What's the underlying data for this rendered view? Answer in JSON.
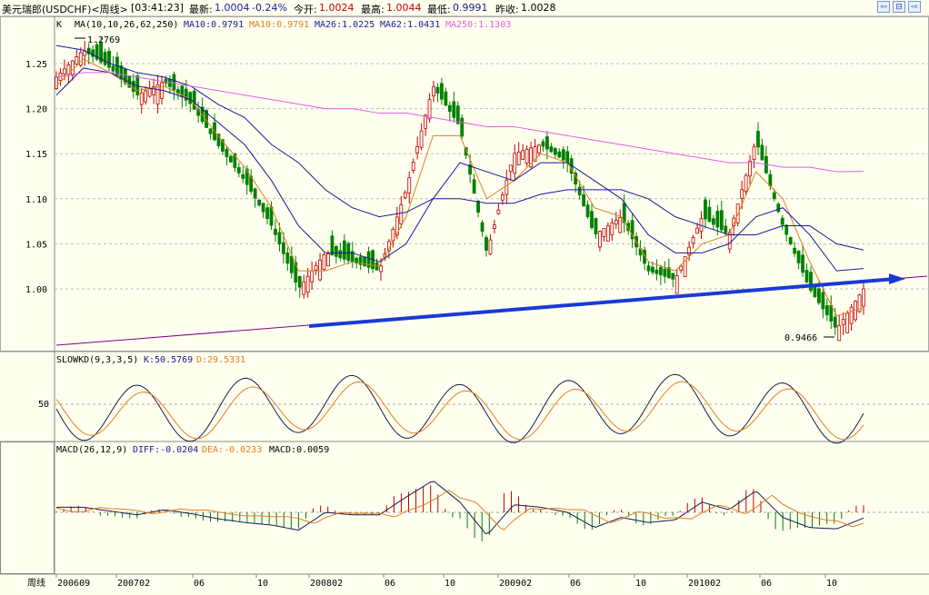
{
  "header": {
    "symbol": "美元瑞郎(USDCHF)<周线>",
    "time": "[03:41:23]",
    "latest_label": "最新:",
    "latest": "1.0004",
    "change": "-0.24%",
    "open_label": "今开:",
    "open": "1.0024",
    "high_label": "最高:",
    "high": "1.0044",
    "low_label": "最低:",
    "low": "0.9991",
    "prev_label": "昨收:",
    "prev": "1.0028",
    "nav_buttons": [
      "prev-arrow-icon",
      "expand-icon",
      "next-arrow-icon"
    ]
  },
  "main_panel": {
    "k_label": "K",
    "ma_label": "MA(10,10,26,62,250)",
    "ma_values": [
      {
        "text": "MA10:0.9791",
        "color": "#1a1a9a"
      },
      {
        "text": "MA10:0.9791",
        "color": "#e08020"
      },
      {
        "text": "MA26:1.0225",
        "color": "#1a1a9a"
      },
      {
        "text": "MA62:1.0431",
        "color": "#1a1a9a"
      },
      {
        "text": "MA250:1.1303",
        "color": "#e060e0"
      }
    ],
    "high_annotation": "1.2769",
    "low_annotation": "0.9466",
    "y_ticks": [
      "1.25",
      "1.20",
      "1.15",
      "1.10",
      "1.05",
      "1.00"
    ]
  },
  "kd_panel": {
    "label": "SLOWKD(9,3,3,5)",
    "k_text": "K:50.5769",
    "d_text": "D:29.5331",
    "y_tick": "50"
  },
  "macd_panel": {
    "label": "MACD(26,12,9)",
    "diff_text": "DIFF:-0.0204",
    "dea_text": "DEA:-0.0233",
    "macd_text": "MACD:0.0059",
    "y_tick": "0"
  },
  "x_axis": {
    "period_label": "周线",
    "ticks": [
      "200609",
      "200702",
      "06",
      "10",
      "200802",
      "06",
      "10",
      "200902",
      "06",
      "10",
      "201002",
      "06",
      "10"
    ]
  },
  "chart_data": {
    "type": "line",
    "title": "美元瑞郎(USDCHF)<周线>",
    "xlabel": "",
    "ylabel": "",
    "ylim": [
      0.935,
      1.29
    ],
    "x": [
      "2006-09",
      "2006-11",
      "2007-02",
      "2007-04",
      "2007-06",
      "2007-08",
      "2007-10",
      "2007-12",
      "2008-02",
      "2008-03",
      "2008-04",
      "2008-06",
      "2008-08",
      "2008-10",
      "2008-11",
      "2008-12",
      "2009-02",
      "2009-03",
      "2009-05",
      "2009-06",
      "2009-08",
      "2009-10",
      "2009-11",
      "2010-01",
      "2010-02",
      "2010-04",
      "2010-06",
      "2010-07",
      "2010-08",
      "2010-10",
      "2010-11"
    ],
    "series": [
      {
        "name": "K",
        "color": "#008000",
        "values": [
          1.235,
          1.265,
          1.245,
          1.215,
          1.23,
          1.205,
          1.16,
          1.12,
          1.07,
          1.0,
          1.04,
          1.03,
          1.02,
          1.11,
          1.225,
          1.18,
          1.04,
          1.15,
          1.16,
          1.14,
          1.06,
          1.08,
          1.02,
          1.01,
          1.08,
          1.06,
          1.165,
          1.07,
          1.0,
          0.955,
          1.0
        ]
      },
      {
        "name": "MA10",
        "color": "#e08020",
        "values": [
          1.225,
          1.255,
          1.24,
          1.22,
          1.225,
          1.21,
          1.17,
          1.135,
          1.09,
          1.02,
          1.02,
          1.03,
          1.025,
          1.08,
          1.17,
          1.17,
          1.1,
          1.12,
          1.15,
          1.14,
          1.09,
          1.08,
          1.03,
          1.02,
          1.05,
          1.06,
          1.13,
          1.1,
          1.03,
          0.97,
          0.979
        ]
      },
      {
        "name": "MA26",
        "color": "#1a1a9a",
        "values": [
          1.215,
          1.245,
          1.24,
          1.225,
          1.22,
          1.21,
          1.185,
          1.16,
          1.12,
          1.07,
          1.04,
          1.04,
          1.03,
          1.05,
          1.1,
          1.14,
          1.13,
          1.12,
          1.14,
          1.14,
          1.12,
          1.1,
          1.06,
          1.04,
          1.04,
          1.05,
          1.08,
          1.09,
          1.06,
          1.02,
          1.0225
        ]
      },
      {
        "name": "MA62",
        "color": "#1a1a9a",
        "values": [
          1.27,
          1.265,
          1.25,
          1.24,
          1.235,
          1.225,
          1.205,
          1.19,
          1.16,
          1.14,
          1.11,
          1.09,
          1.08,
          1.085,
          1.1,
          1.1,
          1.095,
          1.095,
          1.105,
          1.11,
          1.11,
          1.11,
          1.1,
          1.08,
          1.07,
          1.06,
          1.06,
          1.07,
          1.07,
          1.05,
          1.0431
        ]
      },
      {
        "name": "MA250",
        "color": "#e060e0",
        "values": [
          1.235,
          1.24,
          1.24,
          1.235,
          1.23,
          1.225,
          1.22,
          1.215,
          1.21,
          1.205,
          1.2,
          1.2,
          1.195,
          1.195,
          1.19,
          1.185,
          1.18,
          1.18,
          1.175,
          1.17,
          1.165,
          1.16,
          1.155,
          1.15,
          1.145,
          1.14,
          1.14,
          1.135,
          1.135,
          1.13,
          1.1303
        ]
      }
    ]
  }
}
